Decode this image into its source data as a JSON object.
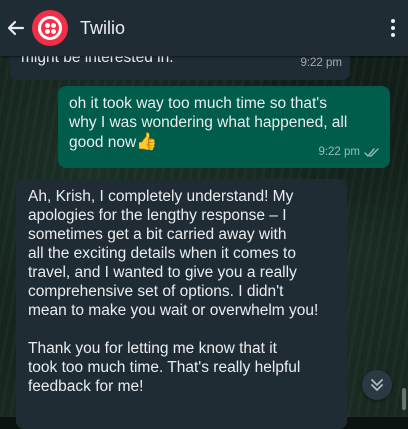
{
  "header": {
    "title": "Twilio",
    "brand_color": "#f22f46"
  },
  "messages": [
    {
      "direction": "incoming",
      "text": "might be interested in.",
      "time": "9:22 pm"
    },
    {
      "direction": "outgoing",
      "text": "oh it took way too much time so that's\nwhy I was wondering what happened, all\ngood now",
      "emoji": "👍",
      "time": "9:22 pm",
      "status": "read"
    },
    {
      "direction": "incoming",
      "text": "Ah, Krish, I completely understand! My\napologies for the lengthy response – I\nsometimes get a bit carried away with\nall the exciting details when it comes to\ntravel, and I wanted to give you a really\ncomprehensive set of options. I didn't\nmean to make you wait or overwhelm you!\n\nThank you for letting me know that it\ntook too much time. That's really helpful\nfeedback for me!"
    }
  ],
  "icons": {
    "back": "arrow-left-icon",
    "menu": "more-vertical-icon",
    "scroll": "double-chevron-down-icon",
    "ticks": "double-check-icon"
  }
}
